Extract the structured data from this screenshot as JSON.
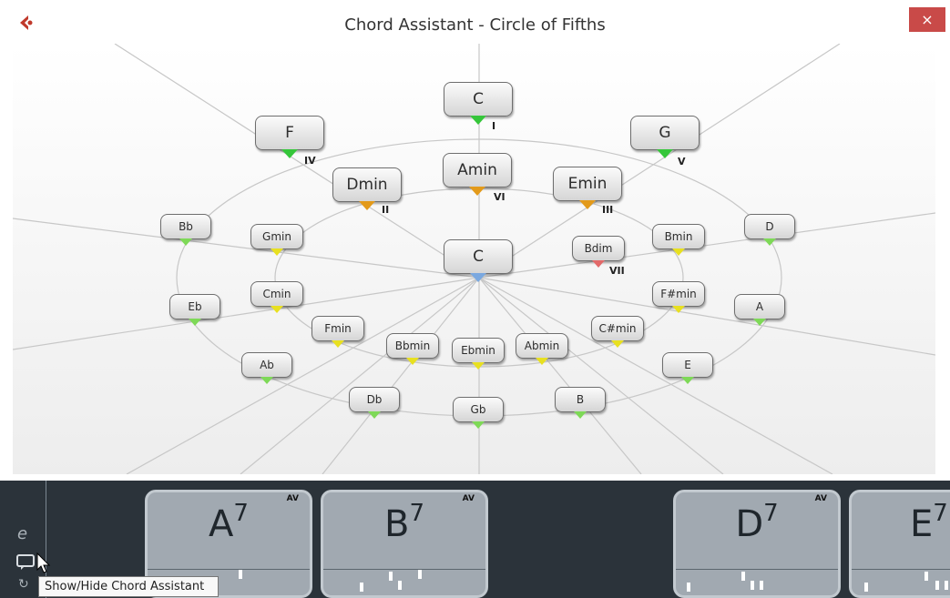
{
  "window": {
    "title": "Chord Assistant - Circle of Fifths",
    "close_label": "×",
    "app_icon": "cubase-logo-icon",
    "close_icon": "close-icon"
  },
  "circle": {
    "center": {
      "label": "C"
    },
    "major_ring": [
      {
        "label": "C",
        "roman": "I",
        "color": "#35c63a"
      },
      {
        "label": "F",
        "roman": "IV",
        "color": "#35c63a"
      },
      {
        "label": "G",
        "roman": "V",
        "color": "#35c63a"
      },
      {
        "label": "Amin",
        "roman": "VI",
        "color": "#e39a1a"
      },
      {
        "label": "Dmin",
        "roman": "II",
        "color": "#e39a1a"
      },
      {
        "label": "Emin",
        "roman": "III",
        "color": "#e39a1a"
      }
    ],
    "outer_nodes": [
      {
        "label": "Bb",
        "color": "#7ed957"
      },
      {
        "label": "D",
        "color": "#7ed957"
      },
      {
        "label": "Eb",
        "color": "#7ed957"
      },
      {
        "label": "A",
        "color": "#7ed957"
      },
      {
        "label": "Ab",
        "color": "#7ed957"
      },
      {
        "label": "E",
        "color": "#7ed957"
      },
      {
        "label": "Db",
        "color": "#7ed957"
      },
      {
        "label": "B",
        "color": "#7ed957"
      },
      {
        "label": "Gb",
        "color": "#7ed957"
      }
    ],
    "inner_nodes": [
      {
        "label": "Gmin",
        "color": "#e8e020"
      },
      {
        "label": "Bmin",
        "color": "#e8e020"
      },
      {
        "label": "Cmin",
        "color": "#e8e020"
      },
      {
        "label": "F#min",
        "color": "#e8e020"
      },
      {
        "label": "Fmin",
        "color": "#e8e020"
      },
      {
        "label": "C#min",
        "color": "#e8e020"
      },
      {
        "label": "Bbmin",
        "color": "#e8e020"
      },
      {
        "label": "Ebmin",
        "color": "#e8e020"
      },
      {
        "label": "Abmin",
        "color": "#e8e020"
      },
      {
        "label": "Bdim",
        "roman": "VII",
        "color": "#e36a6a"
      }
    ],
    "center_color": "#7aa8e0"
  },
  "track": {
    "side_icons": [
      "e-logo-icon",
      "chord-assistant-icon",
      "refresh-icon"
    ],
    "chords": [
      {
        "root": "A",
        "ext": "7",
        "av": "AV"
      },
      {
        "root": "B",
        "ext": "7",
        "av": "AV"
      },
      {
        "root": "D",
        "ext": "7",
        "av": "AV"
      },
      {
        "root": "E",
        "ext": "7",
        "av": ""
      }
    ]
  },
  "tooltip": {
    "text": "Show/Hide Chord Assistant"
  }
}
